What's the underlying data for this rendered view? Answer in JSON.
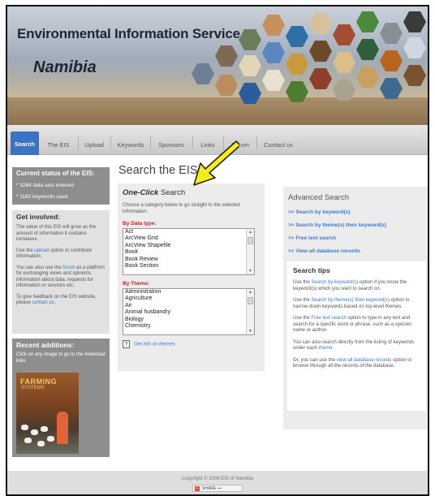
{
  "header": {
    "title": "Environmental Information Service",
    "subtitle": "Namibia"
  },
  "nav": {
    "tabs": [
      {
        "label": "Search",
        "active": true
      },
      {
        "label": "The EIS",
        "active": false
      },
      {
        "label": "Upload",
        "active": false
      },
      {
        "label": "Keywords",
        "active": false
      },
      {
        "label": "Sponsors",
        "active": false
      },
      {
        "label": "Links",
        "active": false
      },
      {
        "label": "Forum",
        "active": false
      },
      {
        "label": "Contact us",
        "active": false
      }
    ]
  },
  "sidebar": {
    "status": {
      "heading": "Current status of the EIS:",
      "datasets": "* 3284 data sets entered",
      "keywords": "* 1162 keywords used"
    },
    "get_involved": {
      "heading": "Get involved:",
      "p1": "The value of this EIS will grow as the amount of information it contains increases.",
      "p2_pre": "Use the ",
      "p2_link": "upload",
      "p2_post": " option to contribute information.",
      "p3_pre": "You can also use the ",
      "p3_link": "forum",
      "p3_post": " as a platform for exchanging views and opinions, information about data, requests for information or services etc.",
      "p4_pre": "To give feedback on the EIS website, please ",
      "p4_link": "contact us",
      "p4_post": "."
    },
    "recent": {
      "heading": "Recent additions:",
      "text": "Click on any image to go to the download links",
      "cover_title": "FARMING",
      "cover_sub": "SYSTEMS"
    }
  },
  "main": {
    "title": "Search the EIS",
    "one_click": {
      "heading_italic": "One-Click",
      "heading_rest": " Search",
      "desc": "Choose a category below to go straight to the selected information.",
      "by_type_label": "By Data type:",
      "types": [
        "Act",
        "ArcView Grid",
        "ArcView Shapefile",
        "Book",
        "Book Review",
        "Book Section"
      ],
      "by_theme_label": "By Theme:",
      "themes": [
        "Administration",
        "Agriculture",
        "Air",
        "Animal husbandry",
        "Biology",
        "Chemistry"
      ],
      "info_link": "Get info on themes"
    }
  },
  "advanced": {
    "heading": "Advanced Search",
    "links": [
      ">> Search by keyword(s)",
      ">> Search by theme(s) then keyword(s)",
      ">> Free text search",
      ">> View all database records"
    ],
    "tips": {
      "heading": "Search tips",
      "t1_pre": "Use the ",
      "t1_link": "Search by keyword(s)",
      "t1_post": " option if you know the keyword(s) which you want to search on.",
      "t2_pre": "Use the ",
      "t2_link": "Search by theme(s) then keyword(s)",
      "t2_post": " option to narrow down keywords based on top-level themes.",
      "t3_pre": "Use the ",
      "t3_link": "Free text search",
      "t3_post": " option to type in any text and search for a specific word or phrase, such as a species name or author.",
      "t4_pre": "You can also search directly from the listing of keywords under each ",
      "t4_link": "theme",
      "t4_post": ".",
      "t5_pre": "Or, you can use the ",
      "t5_link": "view all database records",
      "t5_post": " option to browse through all the records of the database."
    }
  },
  "footer": {
    "copyright": "Copyright © 2009 EIS of Namibia",
    "share": "SHARE"
  },
  "colors": {
    "accent": "#3a73c2",
    "link": "#3a7bd5",
    "label_red": "#cc2222",
    "arrow": "#f4ec1c"
  }
}
